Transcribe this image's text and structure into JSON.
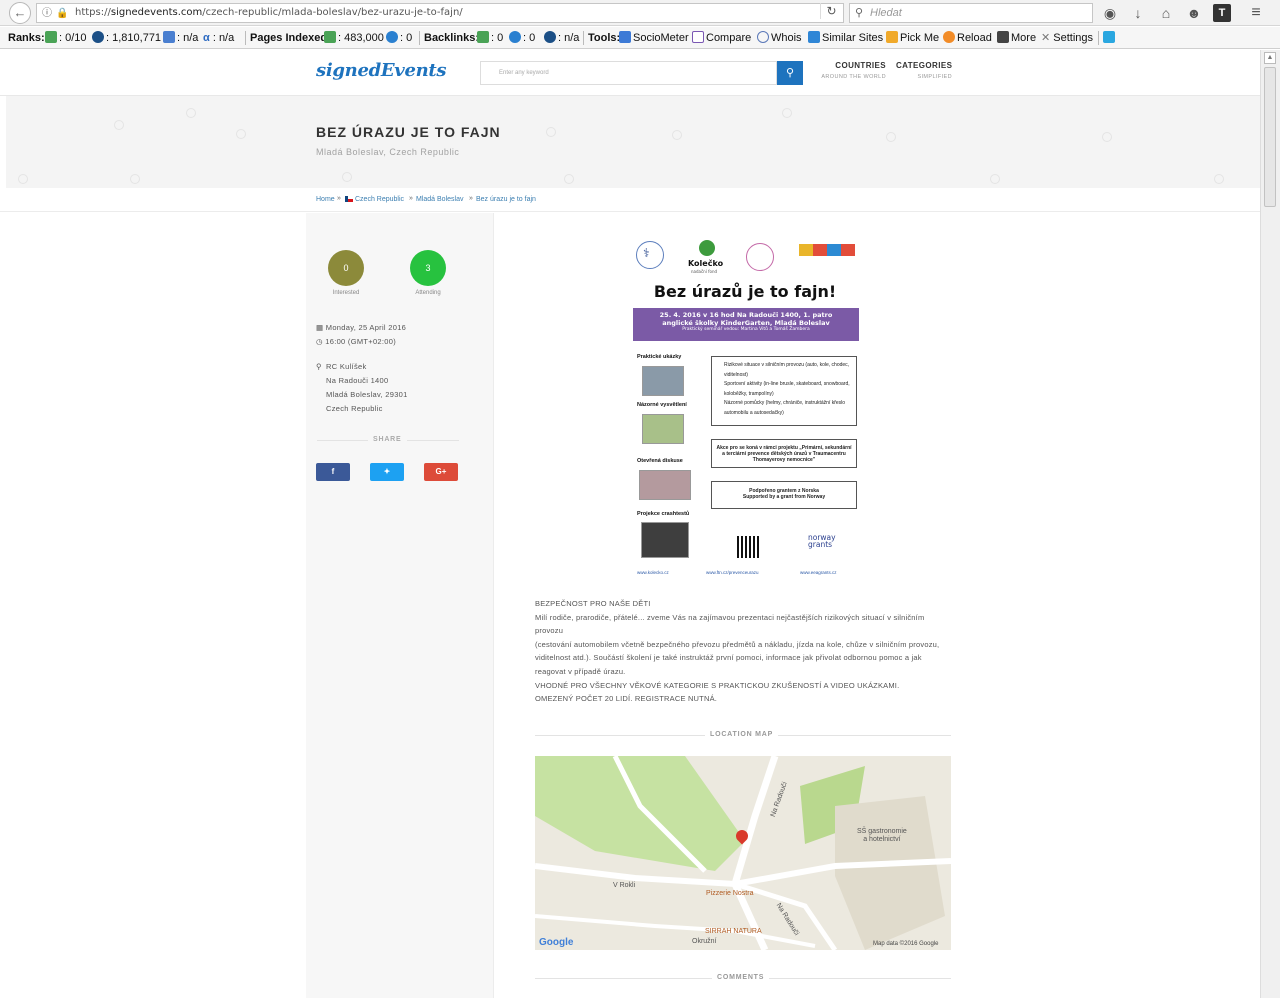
{
  "browser": {
    "url_scheme": "https://",
    "url_domain": "signedevents.com",
    "url_path": "/czech-republic/mlada-boleslav/bez-urazu-je-to-fajn/",
    "search_placeholder": "Hledat"
  },
  "toolbar": {
    "ranks_label": "Ranks:",
    "rank_google": ": 0/10",
    "rank_alexa": ": 1,810,771",
    "rank_compete": ": n/a",
    "rank_quantcast": ": n/a",
    "pages_indexed_label": "Pages Indexed:",
    "pages_google": ": 483,000",
    "pages_bing": ": 0",
    "backlinks_label": "Backlinks:",
    "backlinks_google": ": 0",
    "backlinks_bing": ": 0",
    "backlinks_alexa": ": n/a",
    "tools_label": "Tools:",
    "sociometer": "SocioMeter",
    "compare": "Compare",
    "whois": "Whois",
    "similar_sites": "Similar Sites",
    "pick_me": "Pick Me",
    "reload": "Reload",
    "more": "More",
    "settings": "Settings"
  },
  "site": {
    "logo": "signedEvents",
    "search_placeholder": "Enter any keyword",
    "nav": [
      {
        "title": "COUNTRIES",
        "subtitle": "AROUND THE WORLD"
      },
      {
        "title": "CATEGORIES",
        "subtitle": "SIMPLIFIED"
      }
    ]
  },
  "event": {
    "title": "BEZ ÚRAZU JE TO FAJN",
    "location": "Mladá Boleslav, Czech Republic",
    "breadcrumb": [
      "Home",
      "Czech Republic",
      "Mladá Boleslav",
      "Bez úrazu je to fajn"
    ],
    "interested_count": "0",
    "interested_label": "Interested",
    "attending_count": "3",
    "attending_label": "Attending",
    "date": "Monday, 25 April 2016",
    "time": "16:00 (GMT+02:00)",
    "venue": "RC Kulíšek",
    "street": "Na Radouči 1400",
    "city": "Mladá Boleslav, 29301",
    "country": "Czech Republic",
    "share_label": "SHARE",
    "share_buttons": [
      "f",
      "t",
      "G+"
    ]
  },
  "poster": {
    "logo_kolecko": "Kolečko",
    "logo_kolecko_sub": "nadační fond",
    "headline": "Bez úrazů je to fajn!",
    "banner_line1": "25. 4. 2016 v 16 hod  Na Radouči 1400, 1. patro",
    "banner_line2": "anglické školky KinderGarten, Mladá Boleslav",
    "banner_line3": "Praktický seminář vedou: Martina Vitů a Tomáš Žambera",
    "sec_practical": "Praktické ukázky",
    "sec_visual": "Názorné vysvětlení",
    "sec_discussion": "Otevřená diskuse",
    "sec_crash": "Projekce crashtestů",
    "box1_item1": "Rizikové situace v silničním provozu (auto, kole, chodec, viditelnost)",
    "box1_item2": "Sportovní aktivity (in-line brusle, skateboard, snowboard, koloběžky, trampolíny)",
    "box1_item3": "Názorné pomůcky (helmy, chrániče, instruktážní křeslo automobilu a autosedačky)",
    "box2": "Akce pro se koná v rámci projektu „Primární, sekundární a terciární prevence dětských úrazů v Traumacentru Thomayerovy nemocnice\"",
    "box3_line1": "Podpořeno grantem z Norska",
    "box3_line2": "Supported by a grant from Norway",
    "norway_grants": "norway grants",
    "link1": "www.kolecko.cz",
    "link2": "www.ftn.cz/prevenceurazu",
    "link3": "www.eeagrants.cz"
  },
  "description": {
    "line1": "BEZPEČNOST PRO NAŠE DĚTI",
    "line2": "Milí rodiče, prarodiče, přátelé... zveme Vás na zajímavou prezentaci nejčastějších rizikových situací v silničním provozu",
    "line3": "(cestování automobilem včetně bezpečného převozu předmětů a nákladu, jízda na kole, chůze v silničním provozu, viditelnost atd.). Součástí školení je také instruktáž první pomoci, informace jak přivolat odbornou pomoc a jak reagovat v případě úrazu.",
    "line4": "VHODNÉ PRO VŠECHNY VĚKOVÉ KATEGORIE S PRAKTICKOU ZKUŠENOSTÍ A VIDEO UKÁZKAMI.",
    "line5": "OMEZENÝ POČET 20 LIDÍ. REGISTRACE NUTNÁ."
  },
  "map": {
    "section_label": "LOCATION MAP",
    "street_na_radouci": "Na Radouči",
    "street_v_rokli": "V Rokli",
    "street_okruzni": "Okružní",
    "poi_pizzerie": "Pizzerie Nostra",
    "poi_ss_line1": "SŠ gastronomie",
    "poi_ss_line2": "a hotelnictví",
    "poi_sirrah": "SIRRAH NATURA",
    "google_logo": "Google",
    "map_data": "Map data ©2016 Google"
  },
  "comments": {
    "section_label": "COMMENTS"
  },
  "colors": {
    "brand_blue": "#1e73be",
    "interested": "#8c8a3a",
    "attending": "#27c23f",
    "facebook": "#3b5998",
    "twitter": "#1da1f2",
    "google_plus": "#dd4b39",
    "poster_purple": "#7b5aa6"
  }
}
